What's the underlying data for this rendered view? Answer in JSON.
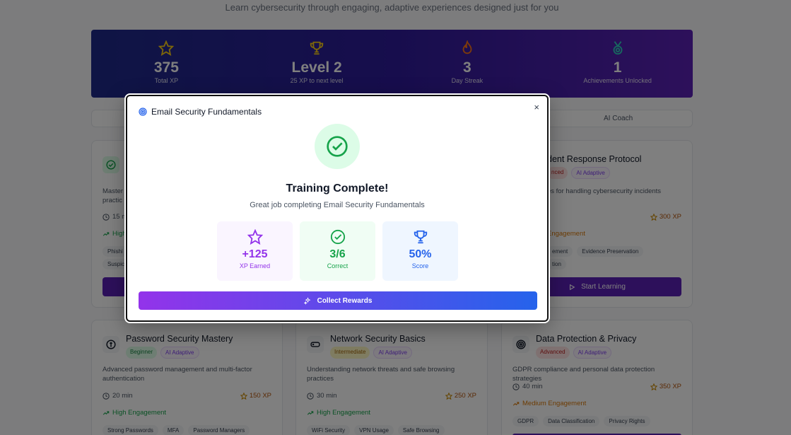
{
  "header": {
    "subtitle": "Learn cybersecurity through engaging, adaptive experiences designed just for you"
  },
  "stats": [
    {
      "icon": "star-icon",
      "value": "375",
      "label": "Total XP"
    },
    {
      "icon": "trophy-icon",
      "value": "Level 2",
      "label": "25 XP to next level"
    },
    {
      "icon": "flame-icon",
      "value": "3",
      "label": "Day Streak"
    },
    {
      "icon": "medal-icon",
      "value": "1",
      "label": "Achievements Unlocked"
    }
  ],
  "tabs": {
    "ai_coach": "AI Coach"
  },
  "cards": {
    "email": {
      "desc_fragment_1": "Master",
      "desc_fragment_2": "practic",
      "duration_fragment": "15 m",
      "engagement_fragment": "High",
      "tag_fragment_1": "Phishi",
      "tag_fragment_2": "Suspic"
    },
    "incident": {
      "title_fragment": "dent Response Protocol",
      "level_fragment": "nced",
      "ai_badge": "AI Adaptive",
      "desc_fragment": "es for handling cybersecurity incidents",
      "xp": "300 XP",
      "engagement_fragment": "Engagement",
      "tag_fragment_1": "ement",
      "tag_2": "Evidence Preservation",
      "tag_fragment_3": "tion",
      "start_label": "Start Learning"
    },
    "password": {
      "title": "Password Security Mastery",
      "level": "Beginner",
      "ai_badge": "AI Adaptive",
      "desc": "Advanced password management and multi-factor authentication",
      "duration": "20 min",
      "xp": "150 XP",
      "engagement": "High Engagement",
      "tags": [
        "Strong Passwords",
        "MFA",
        "Password Managers"
      ]
    },
    "network": {
      "title": "Network Security Basics",
      "level": "Intermediate",
      "ai_badge": "AI Adaptive",
      "desc": "Understanding network threats and safe browsing practices",
      "duration": "30 min",
      "xp": "250 XP",
      "engagement": "High Engagement",
      "tags": [
        "WiFi Security",
        "VPN Usage",
        "Safe Browsing"
      ]
    },
    "privacy": {
      "title": "Data Protection & Privacy",
      "level": "Advanced",
      "ai_badge": "AI Adaptive",
      "desc": "GDPR compliance and personal data protection strategies",
      "duration": "40 min",
      "xp": "350 XP",
      "engagement": "Medium Engagement",
      "tags": [
        "GDPR",
        "Data Classification",
        "Privacy Rights"
      ]
    }
  },
  "modal": {
    "title": "Email Security Fundamentals",
    "close": "×",
    "heading": "Training Complete!",
    "message": "Great job completing Email Security Fundamentals",
    "results": {
      "xp": {
        "value": "+125",
        "label": "XP Earned"
      },
      "correct": {
        "value": "3/6",
        "label": "Correct"
      },
      "score": {
        "value": "50%",
        "label": "Score"
      }
    },
    "collect_label": "Collect Rewards"
  },
  "colors": {
    "purple": "#9333ea",
    "blue": "#2563eb",
    "green": "#16a34a",
    "banner_start": "#1e2a8a",
    "banner_end": "#5b21b6"
  }
}
